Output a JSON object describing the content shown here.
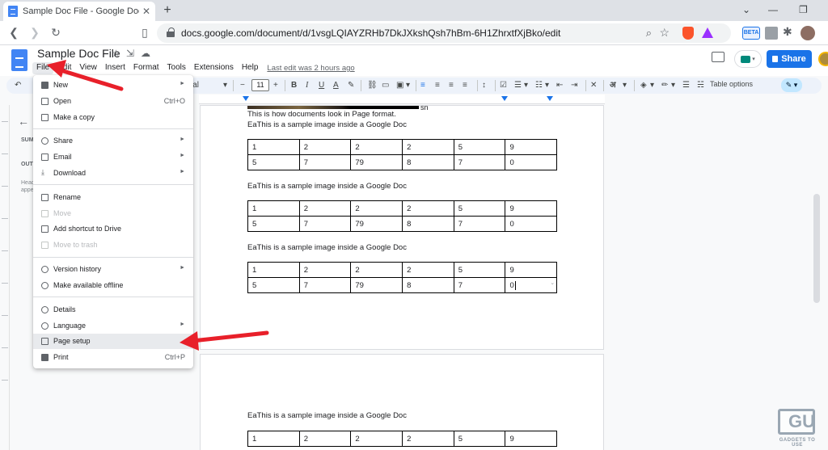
{
  "browser": {
    "tab_title": "Sample Doc File - Google Docs",
    "url": "docs.google.com/document/d/1vsgLQIAYZRHb7DkJXkshQsh7hBm-6H1ZhrxtfXjBko/edit",
    "ext_beta_label": "BETA"
  },
  "docs": {
    "title": "Sample Doc File",
    "menu": [
      "File",
      "Edit",
      "View",
      "Insert",
      "Format",
      "Tools",
      "Extensions",
      "Help"
    ],
    "last_edit": "Last edit was 2 hours ago",
    "share_label": "Share"
  },
  "toolbar": {
    "font_size": "11",
    "font_name_fragment": "ial",
    "table_options": "Table options",
    "style_glyph": "अ"
  },
  "sidebar": {
    "summary_label": "SUM",
    "outline_label": "OUTL",
    "hint": "Head appe"
  },
  "document": {
    "image_suffix": "sn",
    "line1": "This is how documents look in Page format.",
    "caption": "EaThis is a sample image inside a Google Doc",
    "table_rows": [
      [
        "1",
        "2",
        "2",
        "2",
        "5",
        "9"
      ],
      [
        "5",
        "7",
        "79",
        "8",
        "7",
        "0"
      ]
    ]
  },
  "file_menu": {
    "items": [
      {
        "label": "New",
        "submenu": true
      },
      {
        "label": "Open",
        "shortcut": "Ctrl+O"
      },
      {
        "label": "Make a copy"
      },
      {
        "label": "Share",
        "submenu": true
      },
      {
        "label": "Email",
        "submenu": true
      },
      {
        "label": "Download",
        "submenu": true
      },
      {
        "label": "Rename"
      },
      {
        "label": "Move",
        "disabled": true
      },
      {
        "label": "Add shortcut to Drive"
      },
      {
        "label": "Move to trash",
        "disabled": true
      },
      {
        "label": "Version history",
        "submenu": true
      },
      {
        "label": "Make available offline"
      },
      {
        "label": "Details"
      },
      {
        "label": "Language",
        "submenu": true
      },
      {
        "label": "Page setup",
        "highlighted": true
      },
      {
        "label": "Print",
        "shortcut": "Ctrl+P"
      }
    ]
  },
  "watermark": {
    "logo_text": "GU",
    "text": "GADGETS TO USE"
  },
  "colors": {
    "accent": "#1a73e8",
    "arrow": "#e8202a"
  }
}
